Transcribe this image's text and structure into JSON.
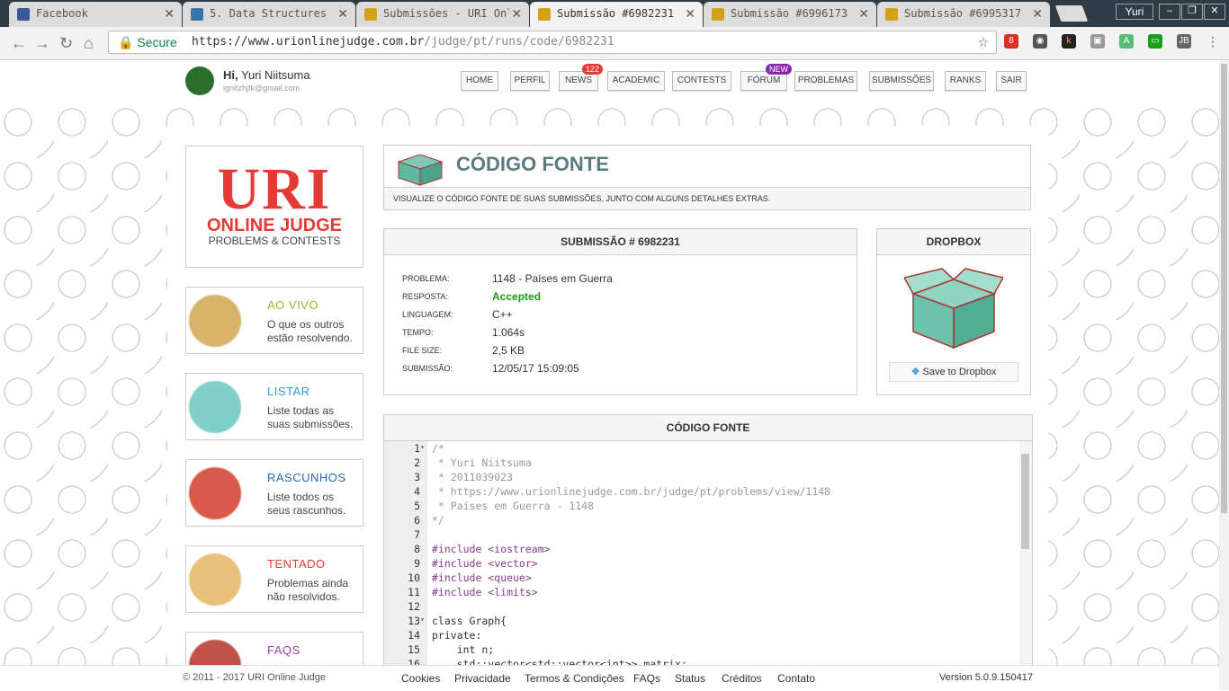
{
  "tabs": [
    {
      "label": "Facebook",
      "active": false
    },
    {
      "label": "5. Data Structures",
      "active": false
    },
    {
      "label": "Submissões - URI Online Judge",
      "active": false
    },
    {
      "label": "Submissão #6982231",
      "active": true
    },
    {
      "label": "Submissão #6996173",
      "active": false
    },
    {
      "label": "Submissão #6995317",
      "active": false
    }
  ],
  "profile": "Yuri",
  "omnibox": {
    "secure": "Secure",
    "url_host": "https://www.urionlinejudge.com.br",
    "url_path": "/judge/pt/runs/code/6982231"
  },
  "extensions": {
    "gmail_count": "8"
  },
  "user": {
    "greeting": "Hi,",
    "name": "Yuri Niitsuma",
    "email": "ignitzhjfk@gmail.com"
  },
  "nav": [
    {
      "label": "HOME"
    },
    {
      "label": "PERFIL"
    },
    {
      "label": "NEWS",
      "badge": "122"
    },
    {
      "label": "ACADEMIC"
    },
    {
      "label": "CONTESTS"
    },
    {
      "label": "FÓRUM",
      "badge": "NEW"
    },
    {
      "label": "PROBLEMAS"
    },
    {
      "label": "SUBMISSÕES"
    },
    {
      "label": "RANKS"
    },
    {
      "label": "SAIR"
    }
  ],
  "logo": {
    "big": "URI",
    "mid": "ONLINE JUDGE",
    "small": "PROBLEMS & CONTESTS"
  },
  "sidebar": [
    {
      "title": "AO VIVO",
      "desc": "O que os outros estão resolvendo.",
      "color": "#8bbf2f"
    },
    {
      "title": "LISTAR",
      "desc": "Liste todas as suas submissões.",
      "color": "#2a9fd6"
    },
    {
      "title": "RASCUNHOS",
      "desc": "Liste todos os seus rascunhos.",
      "color": "#2a6aa8"
    },
    {
      "title": "TENTADO",
      "desc": "Problemas ainda não resolvidos.",
      "color": "#e53935"
    },
    {
      "title": "FAQS",
      "desc": "",
      "color": "#9c3fae"
    }
  ],
  "source_header": {
    "title": "CÓDIGO FONTE",
    "subtitle": "VISUALIZE O CÓDIGO FONTE DE SUAS SUBMISSÕES, JUNTO COM ALGUNS DETALHES EXTRAS."
  },
  "submission": {
    "title": "SUBMISSÃO # 6982231",
    "fields": [
      {
        "key": "PROBLEMA:",
        "value": "1148 - Países em Guerra"
      },
      {
        "key": "RESPOSTA:",
        "value": "Accepted"
      },
      {
        "key": "LINGUAGEM:",
        "value": "C++"
      },
      {
        "key": "TEMPO:",
        "value": "1.064s"
      },
      {
        "key": "FILE SIZE:",
        "value": "2,5 KB"
      },
      {
        "key": "SUBMISSÃO:",
        "value": "12/05/17 15:09:05"
      }
    ],
    "accepted_color": "#1a9e1a"
  },
  "dropbox": {
    "title": "DROPBOX",
    "button": "Save to Dropbox"
  },
  "code": {
    "title": "CÓDIGO FONTE",
    "lines": [
      {
        "n": "1",
        "t": "/*",
        "c": "cm",
        "fold": true
      },
      {
        "n": "2",
        "t": " * Yuri Niitsuma",
        "c": "cm"
      },
      {
        "n": "3",
        "t": " * 2011039023",
        "c": "cm"
      },
      {
        "n": "4",
        "t": " * https://www.urionlinejudge.com.br/judge/pt/problems/view/1148",
        "c": "cm"
      },
      {
        "n": "5",
        "t": " * Países em Guerra - 1148",
        "c": "cm"
      },
      {
        "n": "6",
        "t": "*/",
        "c": "cm"
      },
      {
        "n": "7",
        "t": "",
        "c": ""
      },
      {
        "n": "8",
        "t": "#include <iostream>",
        "c": "kw"
      },
      {
        "n": "9",
        "t": "#include <vector>",
        "c": "kw"
      },
      {
        "n": "10",
        "t": "#include <queue>",
        "c": "kw"
      },
      {
        "n": "11",
        "t": "#include <limits>",
        "c": "kw"
      },
      {
        "n": "12",
        "t": "",
        "c": ""
      },
      {
        "n": "13",
        "t": "class Graph{",
        "c": "",
        "fold": true
      },
      {
        "n": "14",
        "t": "private:",
        "c": ""
      },
      {
        "n": "15",
        "t": "    int n;",
        "c": ""
      },
      {
        "n": "16",
        "t": "    std::vector<std::vector<int>> matrix;",
        "c": ""
      }
    ]
  },
  "footer": {
    "copyright": "© 2011 - 2017 URI Online Judge",
    "links": [
      "Cookies",
      "Privacidade",
      "Termos & Condições",
      "FAQs",
      "Status",
      "Créditos",
      "Contato"
    ],
    "version": "Version 5.0.9.150417"
  }
}
